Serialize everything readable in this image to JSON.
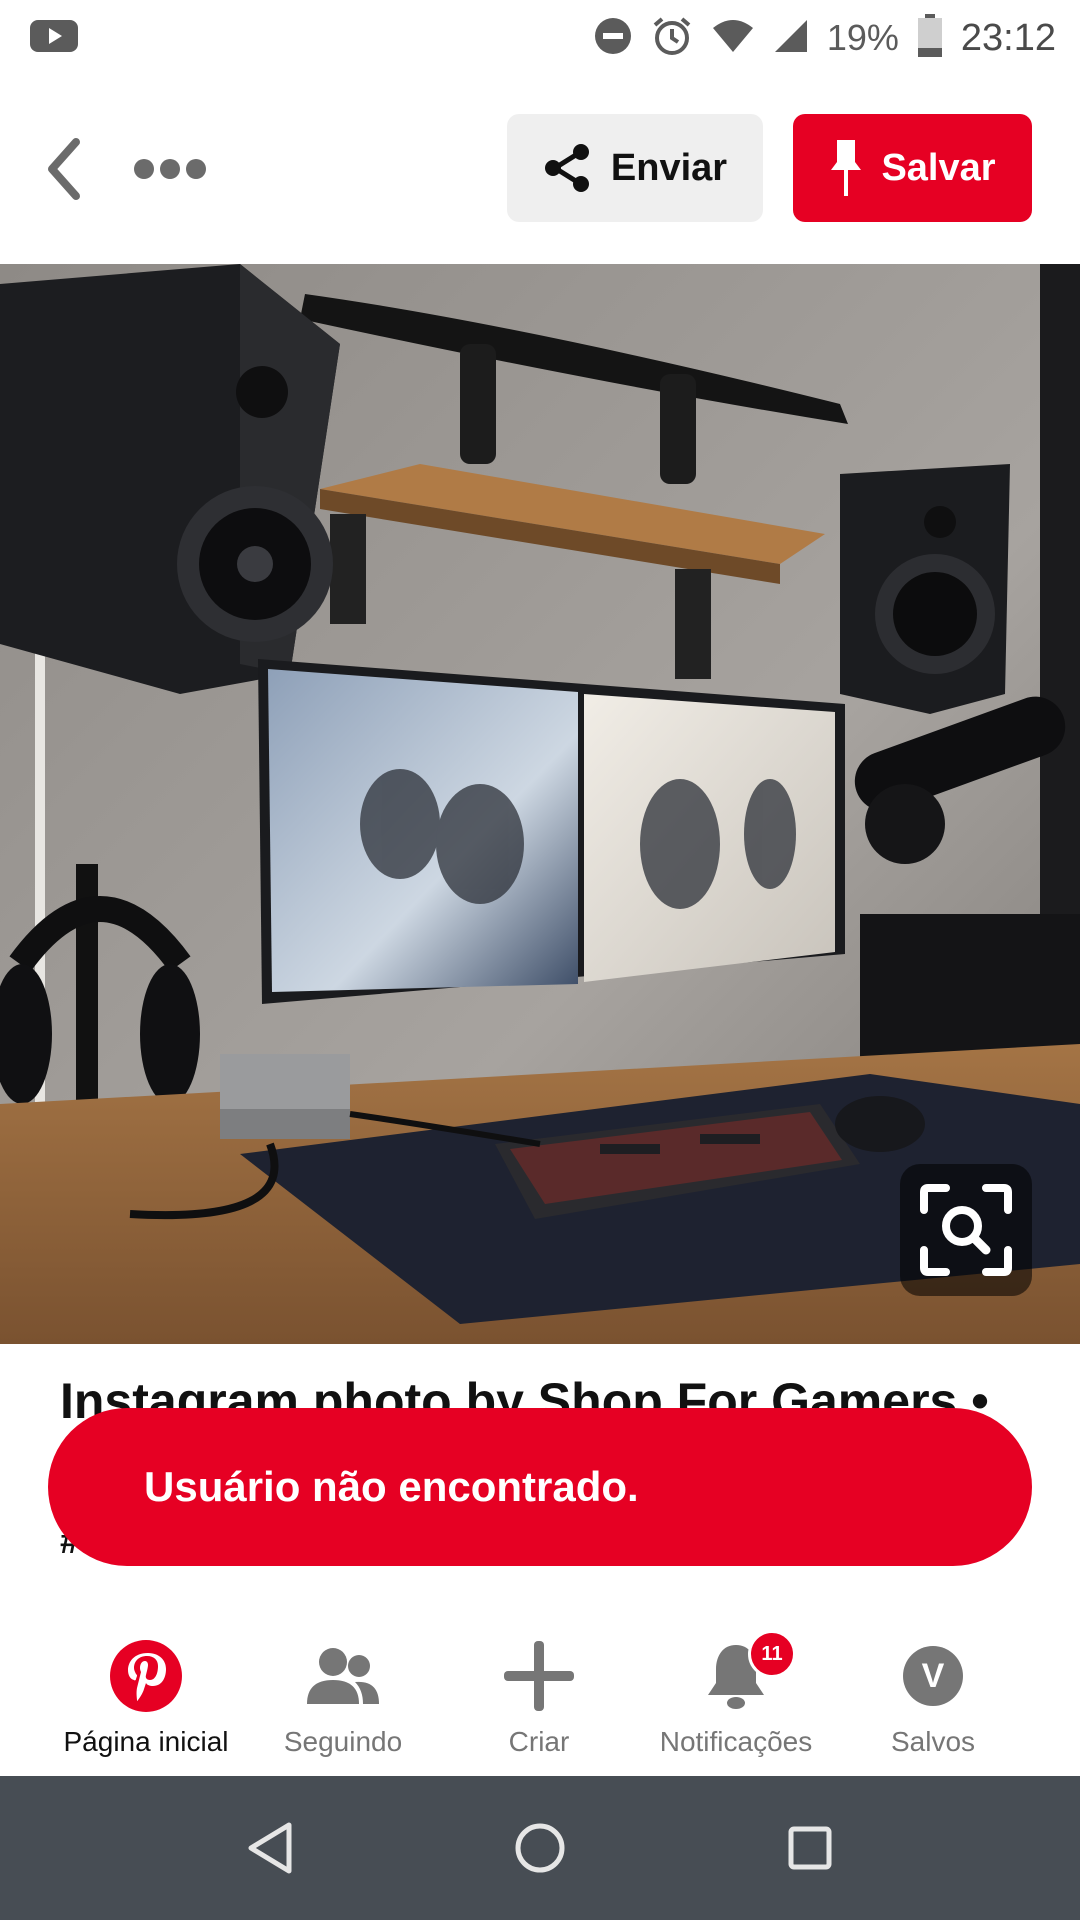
{
  "status_bar": {
    "battery_percent": "19%",
    "time": "23:12",
    "icons": [
      "youtube-icon",
      "do-not-disturb-icon",
      "alarm-icon",
      "wifi-icon",
      "cell-signal-icon",
      "battery-icon"
    ]
  },
  "header": {
    "send_label": "Enviar",
    "save_label": "Salvar",
    "icons": [
      "back-icon",
      "more-icon",
      "share-icon",
      "pin-icon"
    ]
  },
  "pin": {
    "title": "Instagram photo by Shop For Gamers •",
    "description_fragment": "#",
    "visual_search_icon": "visual-search-icon"
  },
  "toast": {
    "message": "Usuário não encontrado."
  },
  "bottom_nav": {
    "items": [
      {
        "label": "Página inicial",
        "icon": "pinterest-logo-icon",
        "active": true
      },
      {
        "label": "Seguindo",
        "icon": "people-icon",
        "active": false
      },
      {
        "label": "Criar",
        "icon": "plus-icon",
        "active": false
      },
      {
        "label": "Notificações",
        "icon": "bell-icon",
        "active": false,
        "badge": "11"
      },
      {
        "label": "Salvos",
        "icon": "avatar",
        "active": false,
        "avatar_letter": "V"
      }
    ]
  },
  "system_nav": {
    "icons": [
      "back-triangle-icon",
      "home-circle-icon",
      "recents-square-icon"
    ]
  },
  "colors": {
    "brand_red": "#e60023",
    "nav_gray": "#767676",
    "system_bar": "#474d54"
  }
}
